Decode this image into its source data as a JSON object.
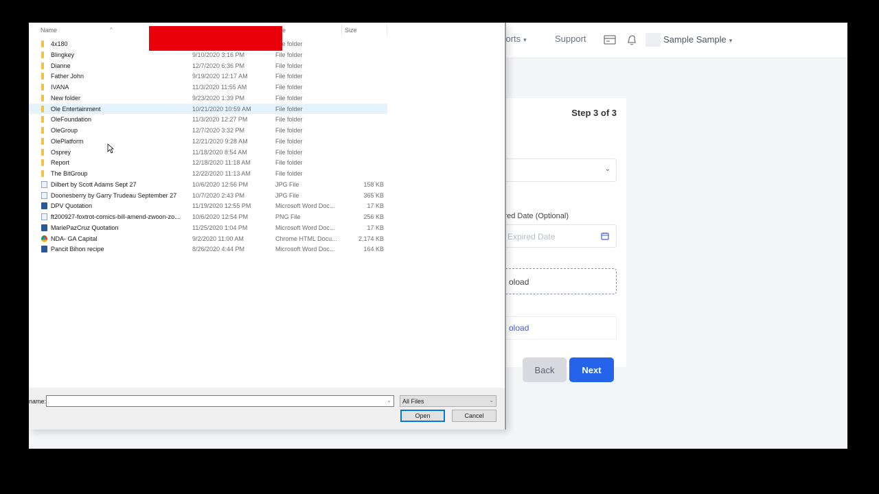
{
  "app": {
    "nav": {
      "reports": "eports",
      "support": "Support"
    },
    "user_name": "Sample Sample",
    "icons": {
      "card": "credit-card-icon",
      "bell": "bell-icon",
      "avatar": "avatar-image-placeholder"
    },
    "wizard": {
      "step": "Step 3 of 3",
      "expired_date_label": "ired Date (Optional)",
      "expired_date_placeholder": "Expired Date",
      "upload_1": "oload",
      "upload_2": "oload",
      "back": "Back",
      "next": "Next"
    },
    "colors": {
      "primary": "#2563eb",
      "link": "#4a5bd6"
    }
  },
  "dialog": {
    "columns": {
      "name": "Name",
      "type": "e",
      "size": "Size"
    },
    "files": [
      {
        "name": "4x180",
        "date": "",
        "type": "File folder",
        "size": "",
        "icon": "folder"
      },
      {
        "name": "Blingkey",
        "date": "9/10/2020 3:16 PM",
        "type": "File folder",
        "size": "",
        "icon": "folder"
      },
      {
        "name": "Dianne",
        "date": "12/7/2020 6:36 PM",
        "type": "File folder",
        "size": "",
        "icon": "folder"
      },
      {
        "name": "Father John",
        "date": "9/19/2020 12:17 AM",
        "type": "File folder",
        "size": "",
        "icon": "folder"
      },
      {
        "name": "IVANA",
        "date": "11/3/2020 11:55 AM",
        "type": "File folder",
        "size": "",
        "icon": "folder"
      },
      {
        "name": "New folder",
        "date": "9/23/2020 1:39 PM",
        "type": "File folder",
        "size": "",
        "icon": "folder"
      },
      {
        "name": "Ole Entertainment",
        "date": "10/21/2020 10:59 AM",
        "type": "File folder",
        "size": "",
        "icon": "folder"
      },
      {
        "name": "OleFoundation",
        "date": "11/3/2020 12:27 PM",
        "type": "File folder",
        "size": "",
        "icon": "folder"
      },
      {
        "name": "OleGroup",
        "date": "12/7/2020 3:32 PM",
        "type": "File folder",
        "size": "",
        "icon": "folder"
      },
      {
        "name": "OlePlatform",
        "date": "12/21/2020 9:28 AM",
        "type": "File folder",
        "size": "",
        "icon": "folder"
      },
      {
        "name": "Osprey",
        "date": "11/18/2020 8:54 AM",
        "type": "File folder",
        "size": "",
        "icon": "folder"
      },
      {
        "name": "Report",
        "date": "12/18/2020 11:18 AM",
        "type": "File folder",
        "size": "",
        "icon": "folder"
      },
      {
        "name": "The BitGroup",
        "date": "12/22/2020 11:13 AM",
        "type": "File folder",
        "size": "",
        "icon": "folder"
      },
      {
        "name": "Dilbert by Scott Adams Sept 27",
        "date": "10/6/2020 12:56 PM",
        "type": "JPG File",
        "size": "158 KB",
        "icon": "image"
      },
      {
        "name": "Doonesberry by Garry Trudeau September 27",
        "date": "10/7/2020 2:43 PM",
        "type": "JPG File",
        "size": "365 KB",
        "icon": "image"
      },
      {
        "name": "DPV Quotation",
        "date": "11/19/2020 12:55 PM",
        "type": "Microsoft Word Doc...",
        "size": "17 KB",
        "icon": "word"
      },
      {
        "name": "ft200927-foxtrot-comics-bill-amend-zwoon-zo...",
        "date": "10/6/2020 12:54 PM",
        "type": "PNG File",
        "size": "256 KB",
        "icon": "image"
      },
      {
        "name": "MariePazCruz Quotation",
        "date": "11/25/2020 1:04 PM",
        "type": "Microsoft Word Doc...",
        "size": "17 KB",
        "icon": "word"
      },
      {
        "name": "NDA- GA Capital",
        "date": "9/2/2020 11:00 AM",
        "type": "Chrome HTML Docu...",
        "size": "2,174 KB",
        "icon": "chrome"
      },
      {
        "name": "Pancit Bihon recipe",
        "date": "8/26/2020 4:44 PM",
        "type": "Microsoft Word Doc...",
        "size": "164 KB",
        "icon": "word"
      }
    ],
    "hovered_index": 6,
    "file_name_label": "name:",
    "file_name_value": "",
    "filter_value": "All Files",
    "open_label": "Open",
    "cancel_label": "Cancel"
  }
}
